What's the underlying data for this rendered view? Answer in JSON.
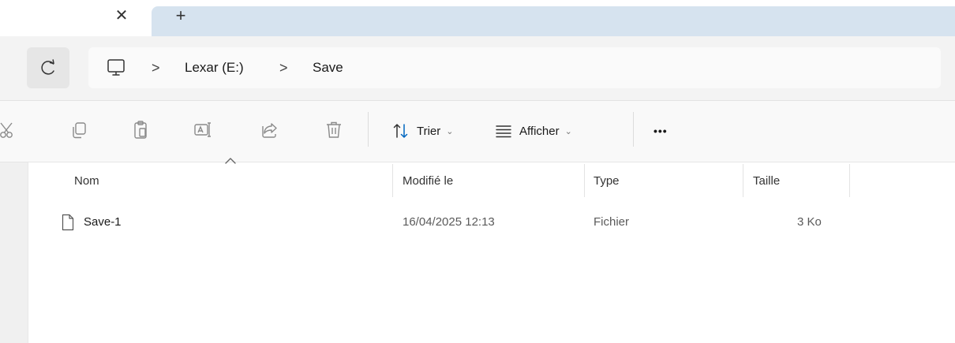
{
  "tabs": {
    "close_glyph": "✕",
    "new_tab_glyph": "+"
  },
  "address_bar": {
    "separator": ">",
    "crumbs": [
      "Lexar (E:)",
      "Save"
    ]
  },
  "toolbar": {
    "icons": [
      "cut-icon",
      "copy-icon",
      "paste-icon",
      "rename-icon",
      "share-icon",
      "delete-icon"
    ],
    "sort_label": "Trier",
    "view_label": "Afficher",
    "more_label": "•••"
  },
  "file_list": {
    "columns": [
      "Nom",
      "Modifié le",
      "Type",
      "Taille"
    ],
    "rows": [
      {
        "name": "Save-1",
        "modified": "16/04/2025 12:13",
        "type": "Fichier",
        "size": "3 Ko"
      }
    ]
  },
  "colors": {
    "accent": "#0067c0",
    "tab_strip": "#d6e3ef",
    "address_row": "#f3f3f3"
  }
}
